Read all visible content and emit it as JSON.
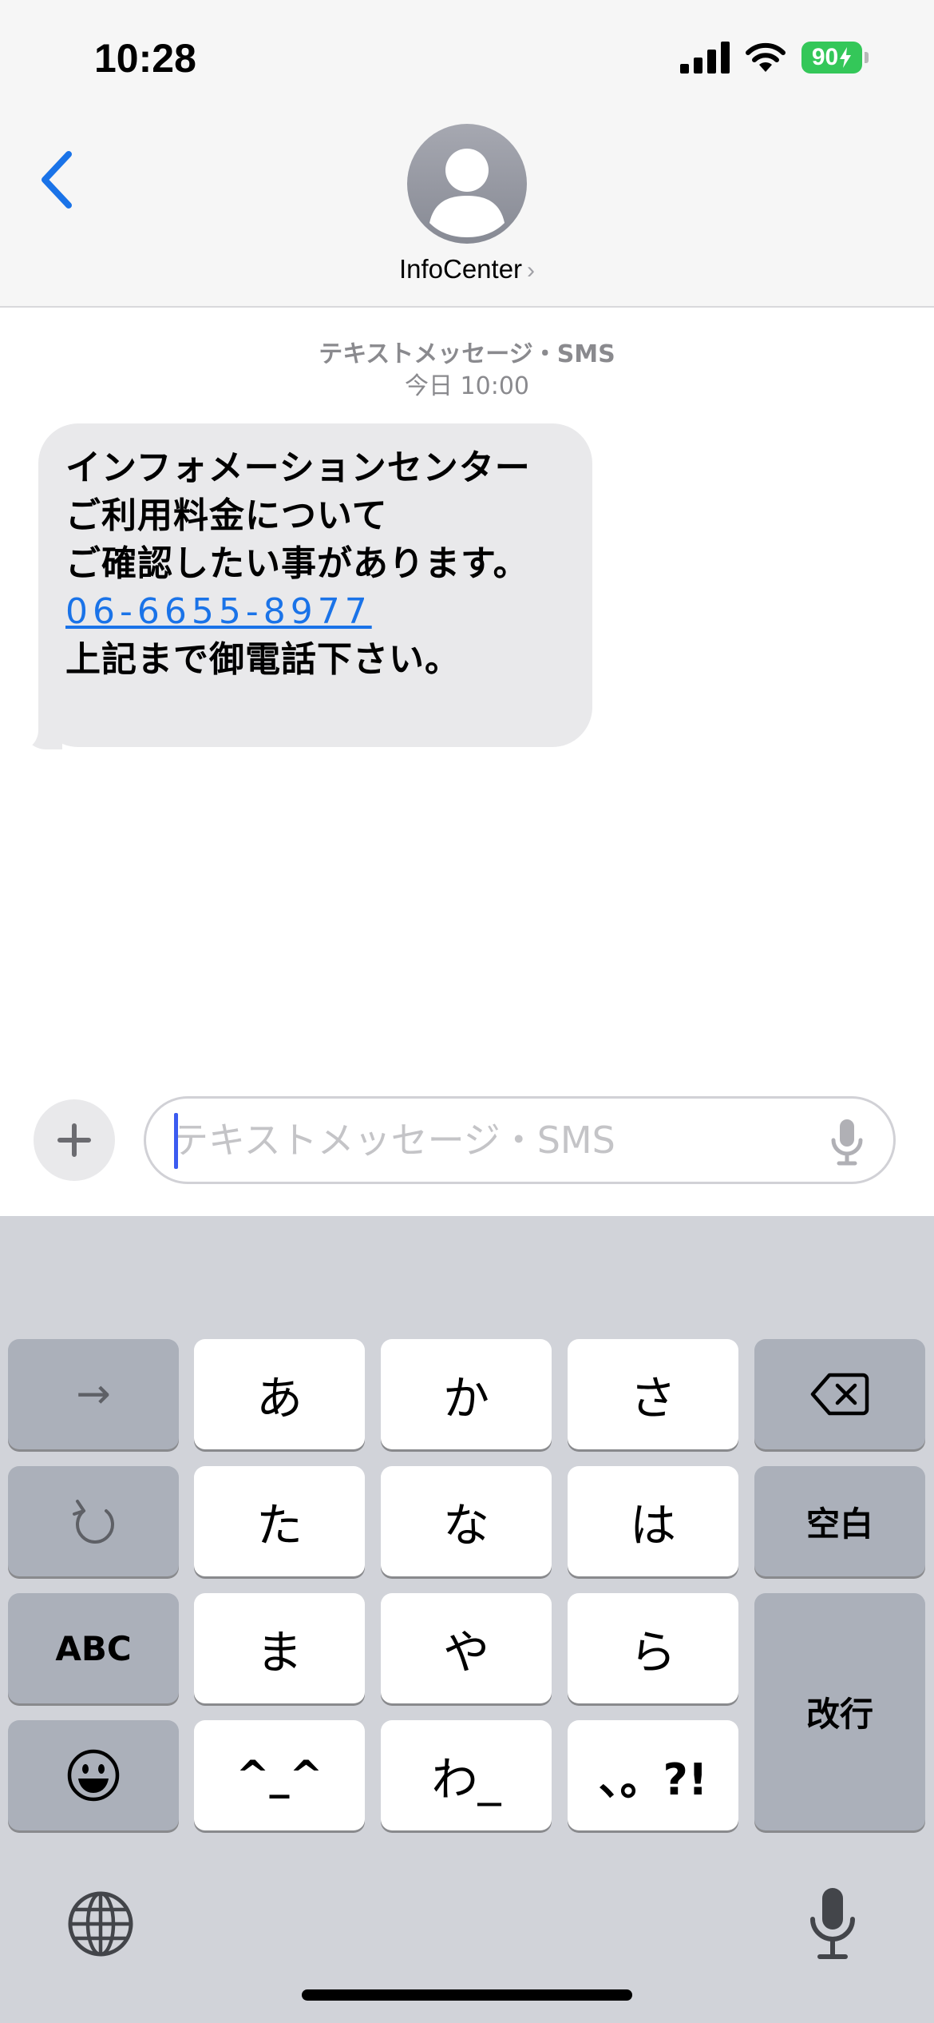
{
  "status_bar": {
    "time": "10:28",
    "battery": "90",
    "icons": [
      "signal-icon",
      "wifi-icon",
      "battery-charging-icon"
    ]
  },
  "header": {
    "back_icon": "chevron-left-icon",
    "avatar_icon": "person-icon",
    "contact_name": "InfoCenter",
    "contact_chevron": "›"
  },
  "conversation": {
    "meta_type": "テキストメッセージ・SMS",
    "meta_time": "今日 10:00",
    "message": {
      "line1": "インフォメーションセンター",
      "line2": "ご利用料金について",
      "line3": "ご確認したい事があります。",
      "phone": "06-6655-8977",
      "line5": "上記まで御電話下さい。"
    }
  },
  "compose": {
    "plus_icon": "plus-icon",
    "placeholder": "テキストメッセージ・SMS",
    "mic_icon": "microphone-icon"
  },
  "keyboard": {
    "row1": [
      "→",
      "あ",
      "か",
      "さ"
    ],
    "row1_backspace_icon": "backspace-icon",
    "row2_undo_icon": "undo-icon",
    "row2": [
      "た",
      "な",
      "は",
      "空白"
    ],
    "row3": [
      "ABC",
      "ま",
      "や",
      "ら"
    ],
    "return_label": "改行",
    "row4_emoji_icon": "emoji-icon",
    "row4": [
      "^_^",
      "わ_",
      "、。?!"
    ],
    "globe_icon": "globe-icon",
    "dictation_icon": "microphone-icon"
  },
  "colors": {
    "accent": "#1a73e8",
    "incoming_bubble": "#e9e9eb",
    "keyboard_bg": "#d1d3d9",
    "func_key": "#abb0ba",
    "battery": "#34c759"
  }
}
